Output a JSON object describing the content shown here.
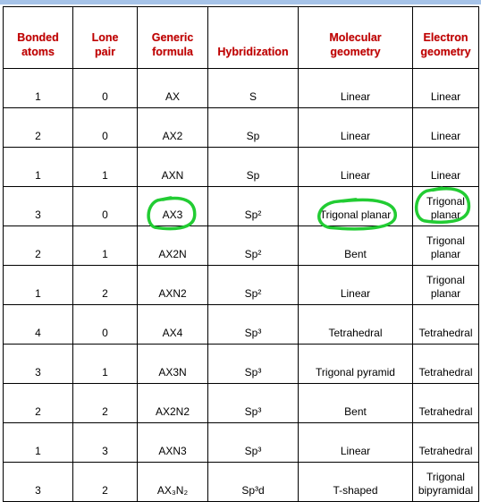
{
  "table": {
    "headers": [
      {
        "line1": "Bonded",
        "line2": "atoms"
      },
      {
        "line1": "Lone",
        "line2": "pair"
      },
      {
        "line1": "Generic",
        "line2": "formula"
      },
      {
        "line1": "",
        "line2": "Hybridization"
      },
      {
        "line1": "Molecular",
        "line2": "geometry"
      },
      {
        "line1": "Electron",
        "line2": "geometry"
      }
    ],
    "rows": [
      {
        "bonded": "1",
        "lone": "0",
        "formula": "AX",
        "hybridization": "S",
        "molecular": "Linear",
        "electron": "Linear"
      },
      {
        "bonded": "2",
        "lone": "0",
        "formula": "AX2",
        "hybridization": "Sp",
        "molecular": "Linear",
        "electron": "Linear"
      },
      {
        "bonded": "1",
        "lone": "1",
        "formula": "AXN",
        "hybridization": "Sp",
        "molecular": "Linear",
        "electron": "Linear"
      },
      {
        "bonded": "3",
        "lone": "0",
        "formula": "AX3",
        "hybridization": "Sp²",
        "molecular": "Trigonal planar",
        "electron": "Trigonal planar",
        "circled": true
      },
      {
        "bonded": "2",
        "lone": "1",
        "formula": "AX2N",
        "hybridization": "Sp²",
        "molecular": "Bent",
        "electron": "Trigonal planar"
      },
      {
        "bonded": "1",
        "lone": "2",
        "formula": "AXN2",
        "hybridization": "Sp²",
        "molecular": "Linear",
        "electron": "Trigonal planar"
      },
      {
        "bonded": "4",
        "lone": "0",
        "formula": "AX4",
        "hybridization": "Sp³",
        "molecular": "Tetrahedral",
        "electron": "Tetrahedral"
      },
      {
        "bonded": "3",
        "lone": "1",
        "formula": "AX3N",
        "hybridization": "Sp³",
        "molecular": "Trigonal pyramid",
        "electron": "Tetrahedral"
      },
      {
        "bonded": "2",
        "lone": "2",
        "formula": "AX2N2",
        "hybridization": "Sp³",
        "molecular": "Bent",
        "electron": "Tetrahedral"
      },
      {
        "bonded": "1",
        "lone": "3",
        "formula": "AXN3",
        "hybridization": "Sp³",
        "molecular": "Linear",
        "electron": "Tetrahedral"
      },
      {
        "bonded": "3",
        "lone": "2",
        "formula": "AX₃N₂",
        "hybridization": "Sp³d",
        "molecular": "T-shaped",
        "electron": "Trigonal bipyramidal"
      }
    ]
  },
  "colors": {
    "header_text": "#c00000",
    "annotation_circle": "#22cc33",
    "top_bar": "#a6c3e8"
  }
}
